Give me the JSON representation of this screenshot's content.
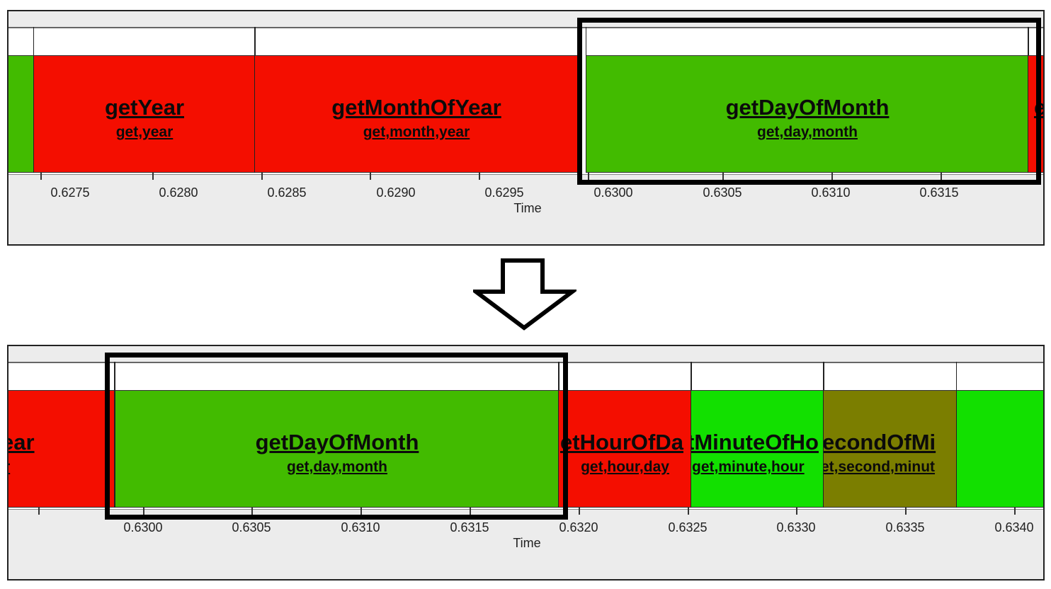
{
  "top": {
    "axis_title": "Time",
    "ticks": [
      "0.6275",
      "0.6280",
      "0.6285",
      "0.6290",
      "0.6295",
      "0.6300",
      "0.6305",
      "0.6310",
      "0.6315"
    ],
    "segments": [
      {
        "name": "",
        "tags": "",
        "color": "#42bb00"
      },
      {
        "name": "getYear",
        "tags": "get,year",
        "color": "#f40e00"
      },
      {
        "name": "getMonthOfYear",
        "tags": "get,month,year",
        "color": "#f40e00"
      },
      {
        "name": "getDayOfMonth",
        "tags": "get,day,month",
        "color": "#42bb00"
      },
      {
        "name": "e",
        "tags": "",
        "color": "#f40e00"
      }
    ]
  },
  "bottom": {
    "axis_title": "Time",
    "ticks": [
      "0.6300",
      "0.6305",
      "0.6310",
      "0.6315",
      "0.6320",
      "0.6325",
      "0.6330",
      "0.6335",
      "0.6340"
    ],
    "segments": [
      {
        "name": "ear",
        "tags": "r",
        "color": "#f40e00"
      },
      {
        "name": "getDayOfMonth",
        "tags": "get,day,month",
        "color": "#42bb00"
      },
      {
        "name": "etHourOfDa",
        "tags": "get,hour,day",
        "color": "#f40e00"
      },
      {
        "name": "tMinuteOfHo",
        "tags": "get,minute,hour",
        "color": "#12e000"
      },
      {
        "name": "econdOfMi",
        "tags": "et,second,minut",
        "color": "#7b7e00"
      },
      {
        "name": "",
        "tags": "",
        "color": "#12e000"
      }
    ]
  },
  "arrow": {
    "icon": "down-arrow-icon"
  }
}
